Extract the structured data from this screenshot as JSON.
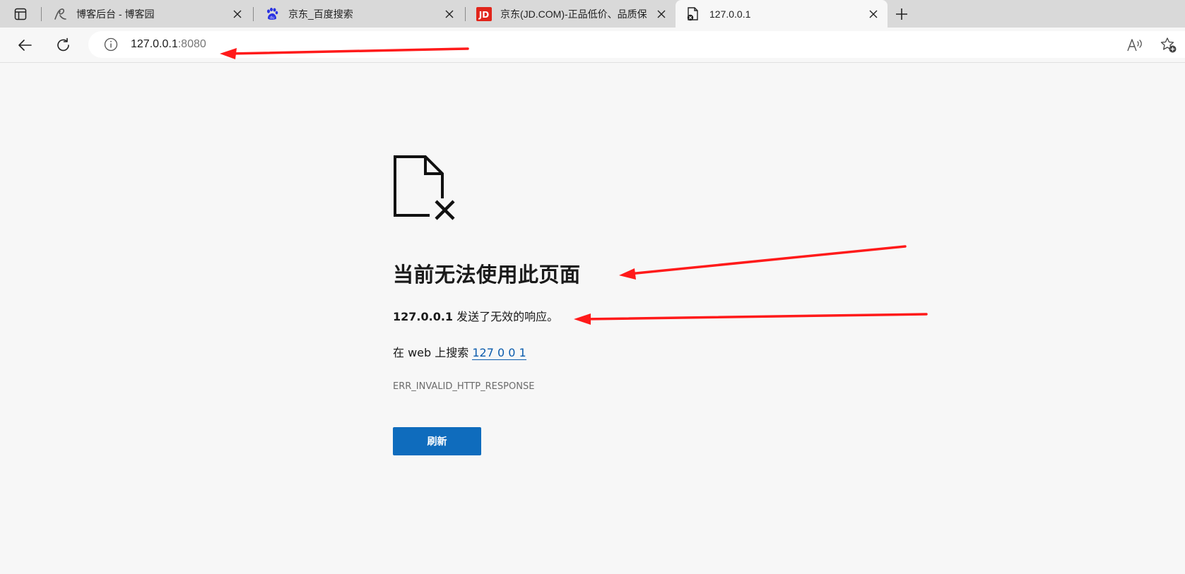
{
  "tabs": [
    {
      "title": "博客后台 - 博客园",
      "favicon": "blog-logo-icon",
      "active": false
    },
    {
      "title": "京东_百度搜索",
      "favicon": "baidu-paw-icon",
      "active": false
    },
    {
      "title": "京东(JD.COM)-正品低价、品质保",
      "favicon": "jd-logo-icon",
      "favicon_text": "JD",
      "active": false
    },
    {
      "title": "127.0.0.1",
      "favicon": "broken-page-icon",
      "active": true
    }
  ],
  "address_bar": {
    "host": "127.0.0.1",
    "port": ":8080"
  },
  "error_page": {
    "heading": "当前无法使用此页面",
    "host": "127.0.0.1",
    "message": " 发送了无效的响应。",
    "search_prefix": "在 web 上搜索 ",
    "search_link": "127 0 0 1",
    "error_code": "ERR_INVALID_HTTP_RESPONSE",
    "refresh_label": "刷新"
  },
  "colors": {
    "accent": "#0f6cbd",
    "link": "#0b5cad",
    "annotation_arrow": "#ff1a1a",
    "jd_red": "#e1251b",
    "baidu_blue": "#2932e1"
  }
}
